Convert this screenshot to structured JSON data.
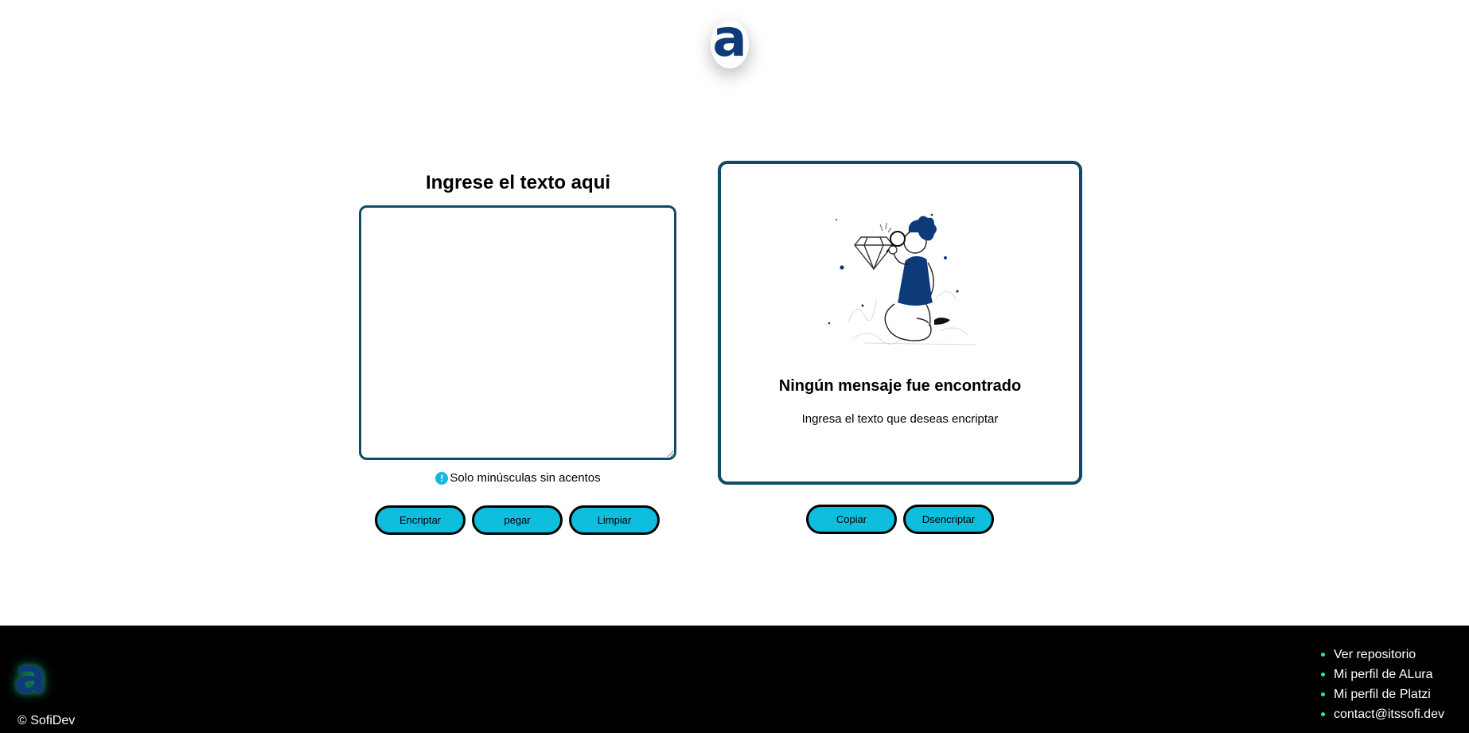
{
  "header": {
    "logo_letter": "a"
  },
  "input_panel": {
    "heading": "Ingrese el texto aqui",
    "textarea_value": "",
    "hint_icon": "info-icon",
    "hint_icon_glyph": "!",
    "hint": "Solo minúsculas sin acentos",
    "buttons": {
      "encrypt": "Encriptar",
      "paste": "pegar",
      "clear": "Limpiar"
    }
  },
  "output_panel": {
    "illustration": "person-with-magnifying-glass-and-diamond",
    "title": "Ningún mensaje fue encontrado",
    "subtitle": "Ingresa el texto que deseas encriptar",
    "buttons": {
      "copy": "Copiar",
      "decrypt": "Dsencriptar"
    }
  },
  "footer": {
    "logo_letter": "a",
    "copyright": "© SofiDev",
    "links": [
      "Ver repositorio",
      "Mi perfil de ALura",
      "Mi perfil de Platzi",
      "contact@itssofi.dev"
    ]
  },
  "colors": {
    "accent": "#0fbddd",
    "border": "#11496b",
    "brand_dark": "#0d3a78",
    "footer_bg": "#000000",
    "bullet": "#1de9b6"
  }
}
